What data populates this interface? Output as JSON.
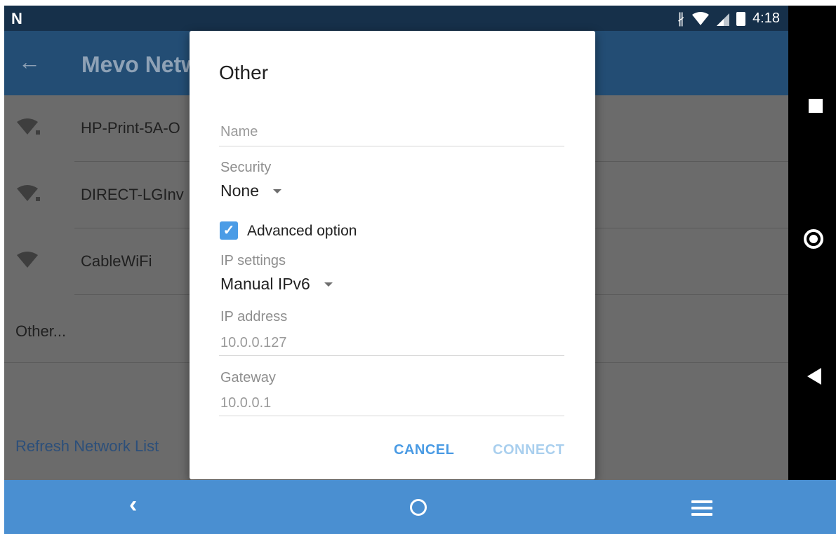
{
  "status_bar": {
    "app_logo": "N",
    "time": "4:18",
    "icons": [
      "bluetooth-icon",
      "wifi-icon",
      "cell-signal-icon",
      "battery-icon"
    ]
  },
  "app_bar": {
    "title": "Mevo Netw"
  },
  "networks": [
    {
      "name": "HP-Print-5A-O"
    },
    {
      "name": "DIRECT-LGInv"
    },
    {
      "name": "CableWiFi"
    }
  ],
  "other_label": "Other...",
  "refresh_label": "Refresh Network List",
  "dialog": {
    "title": "Other",
    "name_placeholder": "Name",
    "security_label": "Security",
    "security_value": "None",
    "advanced_label": "Advanced option",
    "advanced_checked": true,
    "ip_settings_label": "IP settings",
    "ip_settings_value": "Manual IPv6",
    "ip_address_label": "IP address",
    "ip_address_value": "10.0.0.127",
    "gateway_label": "Gateway",
    "gateway_value": "10.0.0.1",
    "cancel_label": "CANCEL",
    "connect_label": "CONNECT"
  },
  "colors": {
    "accent": "#4b9ce6",
    "nav_bar": "#4a8fd1",
    "app_bar": "#234d74"
  }
}
